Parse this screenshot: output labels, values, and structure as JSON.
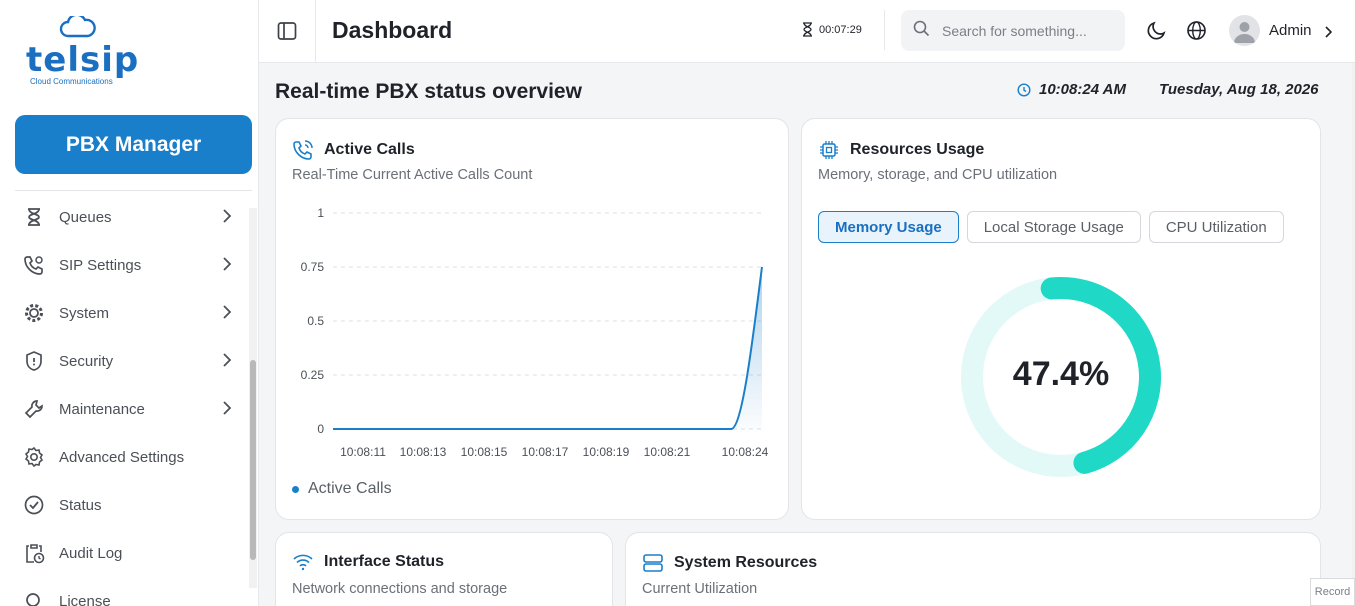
{
  "brand": {
    "name": "telsip",
    "tagline": "Cloud Communications",
    "color": "#1a6fc0"
  },
  "sidebar": {
    "primary_button": "PBX Manager",
    "items": [
      {
        "label": "Queues",
        "icon": "hourglass-icon",
        "has_children": true
      },
      {
        "label": "SIP Settings",
        "icon": "phone-gear-icon",
        "has_children": true
      },
      {
        "label": "System",
        "icon": "cog-icon",
        "has_children": true
      },
      {
        "label": "Security",
        "icon": "shield-icon",
        "has_children": true
      },
      {
        "label": "Maintenance",
        "icon": "wrench-icon",
        "has_children": true
      },
      {
        "label": "Advanced Settings",
        "icon": "gear-icon",
        "has_children": false
      },
      {
        "label": "Status",
        "icon": "check-circle-icon",
        "has_children": false
      },
      {
        "label": "Audit Log",
        "icon": "clipboard-clock-icon",
        "has_children": false
      },
      {
        "label": "License",
        "icon": "search-icon",
        "has_children": false
      }
    ]
  },
  "header": {
    "title": "Dashboard",
    "timer": "00:07:29",
    "search_placeholder": "Search for something...",
    "user": "Admin"
  },
  "main": {
    "title": "Real-time PBX status overview",
    "time": "10:08:24 AM",
    "date": "Tuesday, Aug 18, 2026"
  },
  "active_calls": {
    "title": "Active Calls",
    "subtitle": "Real-Time Current Active Calls Count",
    "legend": "Active Calls"
  },
  "resources": {
    "title": "Resources Usage",
    "subtitle": "Memory, storage, and CPU utilization",
    "tabs": [
      "Memory Usage",
      "Local Storage Usage",
      "CPU Utilization"
    ],
    "active_tab": "Memory Usage",
    "value_label": "47.4%",
    "value": 47.4,
    "ring_color": "#1fd8c6",
    "track_color": "#e2f9f7"
  },
  "interface_status": {
    "title": "Interface Status",
    "subtitle": "Network connections and storage"
  },
  "system_resources": {
    "title": "System Resources",
    "subtitle": "Current Utilization"
  },
  "record_label": "Record",
  "chart_data": {
    "type": "line",
    "x": [
      "10:08:11",
      "10:08:13",
      "10:08:15",
      "10:08:17",
      "10:08:19",
      "10:08:21",
      "10:08:24"
    ],
    "series": [
      {
        "name": "Active Calls",
        "values": [
          0,
          0,
          0,
          0,
          0,
          0,
          0.75
        ]
      }
    ],
    "yticks": [
      "0",
      "0.25",
      "0.5",
      "0.75",
      "1"
    ],
    "ylim": [
      0,
      1
    ],
    "grid": true,
    "legend": "bottom-left",
    "color": "#1a7fca"
  }
}
